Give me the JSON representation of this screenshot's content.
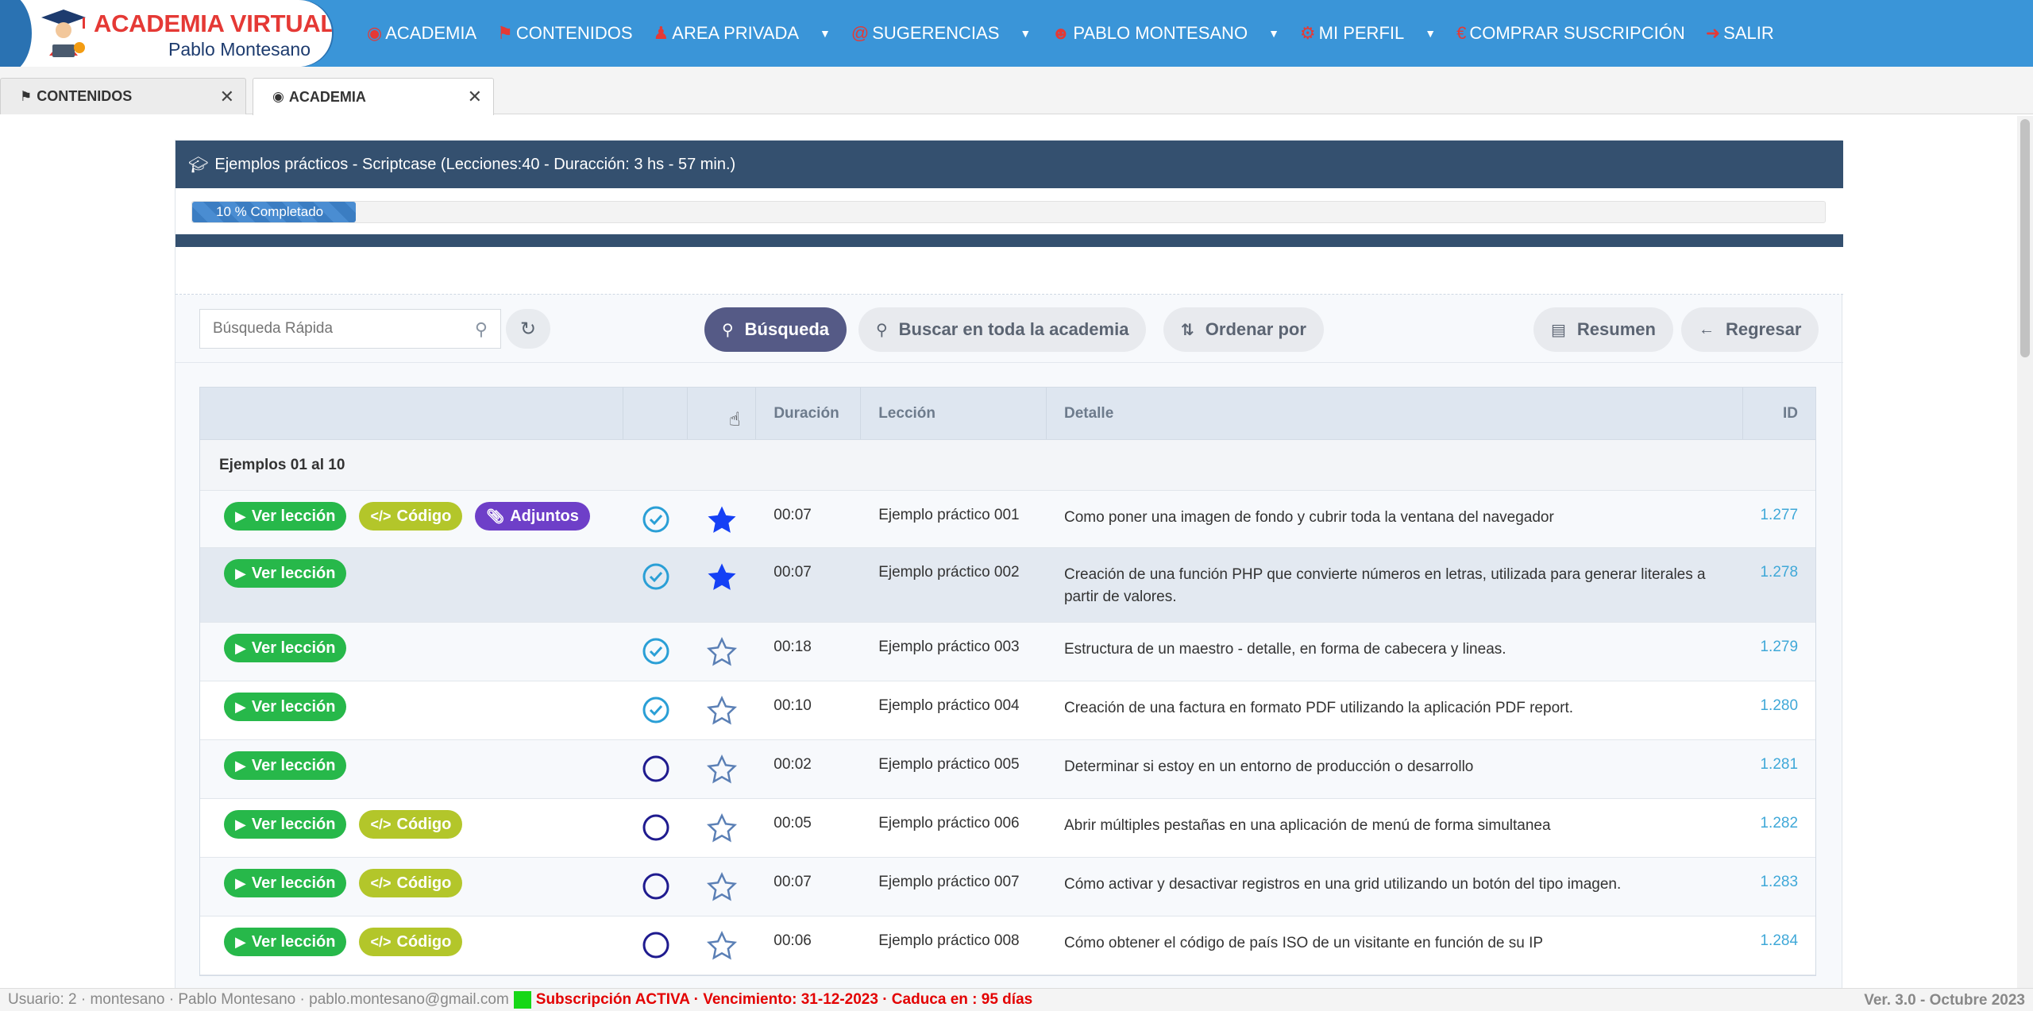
{
  "logo": {
    "title": "ACADEMIA VIRTUAL",
    "subtitle": "Pablo Montesano"
  },
  "nav": [
    {
      "label": "ACADEMIA",
      "icon": "globe-icon",
      "dropdown": false
    },
    {
      "label": "CONTENIDOS",
      "icon": "flask-icon",
      "dropdown": false
    },
    {
      "label": "AREA PRIVADA",
      "icon": "user-tie-icon",
      "dropdown": true
    },
    {
      "label": "SUGERENCIAS",
      "icon": "at-icon",
      "dropdown": true
    },
    {
      "label": "PABLO MONTESANO",
      "icon": "user-icon",
      "dropdown": true
    },
    {
      "label": "MI PERFIL",
      "icon": "gears-icon",
      "dropdown": true
    },
    {
      "label": "COMPRAR SUSCRIPCIÓN",
      "icon": "euro-icon",
      "dropdown": false
    },
    {
      "label": "SALIR",
      "icon": "sign-out-icon",
      "dropdown": false
    }
  ],
  "tabs": [
    {
      "label": "CONTENIDOS",
      "icon": "flask-icon",
      "active": false
    },
    {
      "label": "ACADEMIA",
      "icon": "globe-icon",
      "active": true
    }
  ],
  "course": {
    "title": "Ejemplos prácticos - Scriptcase (Lecciones:40 - Duracción: 3 hs - 57 min.)",
    "progress_label": "10 % Completado",
    "progress_value": 10
  },
  "toolbar": {
    "search_placeholder": "Búsqueda Rápida",
    "search_label": "Búsqueda",
    "search_all_label": "Buscar en toda la academia",
    "sort_label": "Ordenar por",
    "summary_label": "Resumen",
    "back_label": "Regresar"
  },
  "table": {
    "headers": {
      "duration": "Duración",
      "lesson": "Lección",
      "detail": "Detalle",
      "id": "ID"
    },
    "group": "Ejemplos 01 al 10",
    "buttons": {
      "view": "Ver lección",
      "code": "Código",
      "attachments": "Adjuntos"
    },
    "rows": [
      {
        "duration": "00:07",
        "lesson": "Ejemplo práctico 001",
        "detail": "Como poner una imagen de fondo y cubrir toda la ventana del navegador",
        "id": "1.277",
        "code": true,
        "attachments": true,
        "done": true,
        "fav": true
      },
      {
        "duration": "00:07",
        "lesson": "Ejemplo práctico 002",
        "detail": "Creación de una función PHP que convierte números en letras, utilizada para generar literales a partir de valores.",
        "id": "1.278",
        "code": false,
        "attachments": false,
        "done": true,
        "fav": true
      },
      {
        "duration": "00:18",
        "lesson": "Ejemplo práctico 003",
        "detail": "Estructura de un maestro - detalle, en forma de cabecera y lineas.",
        "id": "1.279",
        "code": false,
        "attachments": false,
        "done": true,
        "fav": false
      },
      {
        "duration": "00:10",
        "lesson": "Ejemplo práctico 004",
        "detail": "Creación de una factura en formato PDF utilizando la aplicación PDF report.",
        "id": "1.280",
        "code": false,
        "attachments": false,
        "done": true,
        "fav": false
      },
      {
        "duration": "00:02",
        "lesson": "Ejemplo práctico 005",
        "detail": "Determinar si estoy en un entorno de producción o desarrollo",
        "id": "1.281",
        "code": false,
        "attachments": false,
        "done": false,
        "fav": false
      },
      {
        "duration": "00:05",
        "lesson": "Ejemplo práctico 006",
        "detail": "Abrir múltiples pestañas en una aplicación de menú de forma simultanea",
        "id": "1.282",
        "code": true,
        "attachments": false,
        "done": false,
        "fav": false
      },
      {
        "duration": "00:07",
        "lesson": "Ejemplo práctico 007",
        "detail": "Cómo activar y desactivar registros en una grid utilizando un botón del tipo imagen.",
        "id": "1.283",
        "code": true,
        "attachments": false,
        "done": false,
        "fav": false
      },
      {
        "duration": "00:06",
        "lesson": "Ejemplo práctico 008",
        "detail": "Cómo obtener el código de país ISO de un visitante en función de su IP",
        "id": "1.284",
        "code": true,
        "attachments": false,
        "done": false,
        "fav": false
      }
    ]
  },
  "footer": {
    "user": "Usuario: 2 · montesano · Pablo Montesano · pablo.montesano@gmail.com",
    "subscription": "Subscripción ACTIVA · Vencimiento: 31-12-2023 · Caduca en : 95 días",
    "version": "Ver. 3.0 - Octubre 2023"
  },
  "colors": {
    "nav": "#3a95d8",
    "header": "#34506f",
    "green": "#27b84a",
    "lime": "#b3c62a",
    "purple": "#6e3fc8",
    "id": "#3fa8d8"
  }
}
